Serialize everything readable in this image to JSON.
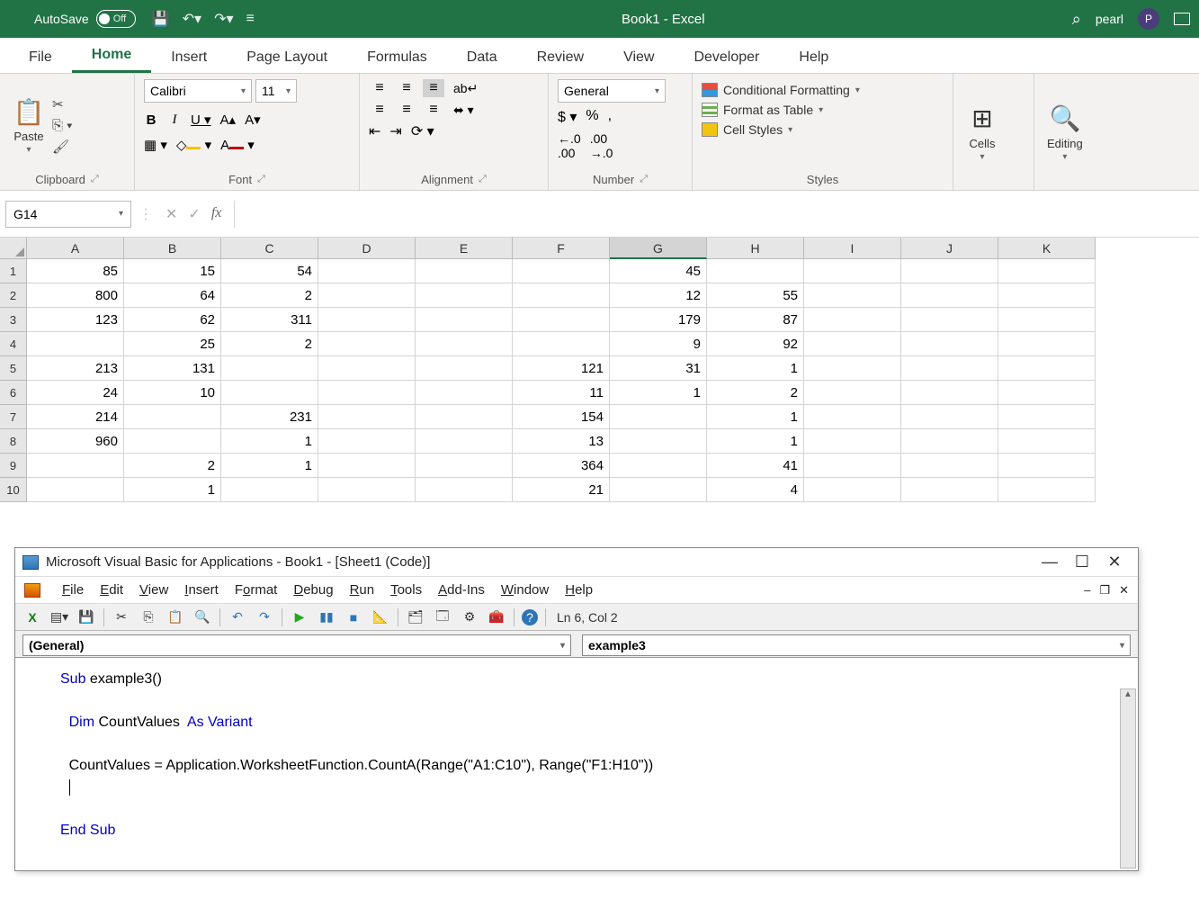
{
  "titlebar": {
    "autosave_label": "AutoSave",
    "toggle_state": "Off",
    "doc_title": "Book1 - Excel",
    "user_name": "pearl",
    "user_initial": "P"
  },
  "ribbon_tabs": [
    "File",
    "Home",
    "Insert",
    "Page Layout",
    "Formulas",
    "Data",
    "Review",
    "View",
    "Developer",
    "Help"
  ],
  "active_tab": "Home",
  "ribbon": {
    "clipboard": {
      "label": "Clipboard",
      "paste": "Paste"
    },
    "font": {
      "label": "Font",
      "name": "Calibri",
      "size": "11"
    },
    "alignment": {
      "label": "Alignment"
    },
    "number": {
      "label": "Number",
      "format": "General"
    },
    "styles": {
      "label": "Styles",
      "cf": "Conditional Formatting",
      "fat": "Format as Table",
      "cs": "Cell Styles"
    },
    "cells": {
      "label": "Cells"
    },
    "editing": {
      "label": "Editing"
    }
  },
  "formula_bar": {
    "name_box": "G14",
    "formula": ""
  },
  "columns": [
    "A",
    "B",
    "C",
    "D",
    "E",
    "F",
    "G",
    "H",
    "I",
    "J",
    "K"
  ],
  "rows": [
    "1",
    "2",
    "3",
    "4",
    "5",
    "6",
    "7",
    "8",
    "9",
    "10"
  ],
  "selected_cell": "G14",
  "selected_col": "G",
  "grid": {
    "A": [
      "85",
      "800",
      "123",
      "",
      "213",
      "24",
      "214",
      "960",
      "",
      ""
    ],
    "B": [
      "15",
      "64",
      "62",
      "25",
      "131",
      "10",
      "",
      "",
      "2",
      "1"
    ],
    "C": [
      "54",
      "2",
      "311",
      "2",
      "",
      "",
      "231",
      "1",
      "1",
      ""
    ],
    "D": [
      "",
      "",
      "",
      "",
      "",
      "",
      "",
      "",
      "",
      ""
    ],
    "E": [
      "",
      "",
      "",
      "",
      "",
      "",
      "",
      "",
      "",
      ""
    ],
    "F": [
      "",
      "",
      "",
      "",
      "121",
      "11",
      "154",
      "13",
      "364",
      "21"
    ],
    "G": [
      "45",
      "12",
      "179",
      "9",
      "31",
      "1",
      "",
      "",
      "",
      ""
    ],
    "H": [
      "",
      "55",
      "87",
      "92",
      "1",
      "2",
      "1",
      "1",
      "41",
      "4"
    ],
    "I": [
      "",
      "",
      "",
      "",
      "",
      "",
      "",
      "",
      "",
      ""
    ],
    "J": [
      "",
      "",
      "",
      "",
      "",
      "",
      "",
      "",
      "",
      ""
    ],
    "K": [
      "",
      "",
      "",
      "",
      "",
      "",
      "",
      "",
      "",
      ""
    ]
  },
  "vba": {
    "title": "Microsoft Visual Basic for Applications - Book1 - [Sheet1 (Code)]",
    "menus": [
      "File",
      "Edit",
      "View",
      "Insert",
      "Format",
      "Debug",
      "Run",
      "Tools",
      "Add-Ins",
      "Window",
      "Help"
    ],
    "cursor": "Ln 6, Col 2",
    "dropdown_left": "(General)",
    "dropdown_right": "example3",
    "code": {
      "l1a": "Sub ",
      "l1b": "example3()",
      "l2a": "Dim ",
      "l2b": "CountValues  ",
      "l2c": "As Variant",
      "l3": "CountValues = Application.WorksheetFunction.CountA(Range(\"A1:C10\"), Range(\"F1:H10\"))",
      "l4": "End Sub"
    }
  }
}
